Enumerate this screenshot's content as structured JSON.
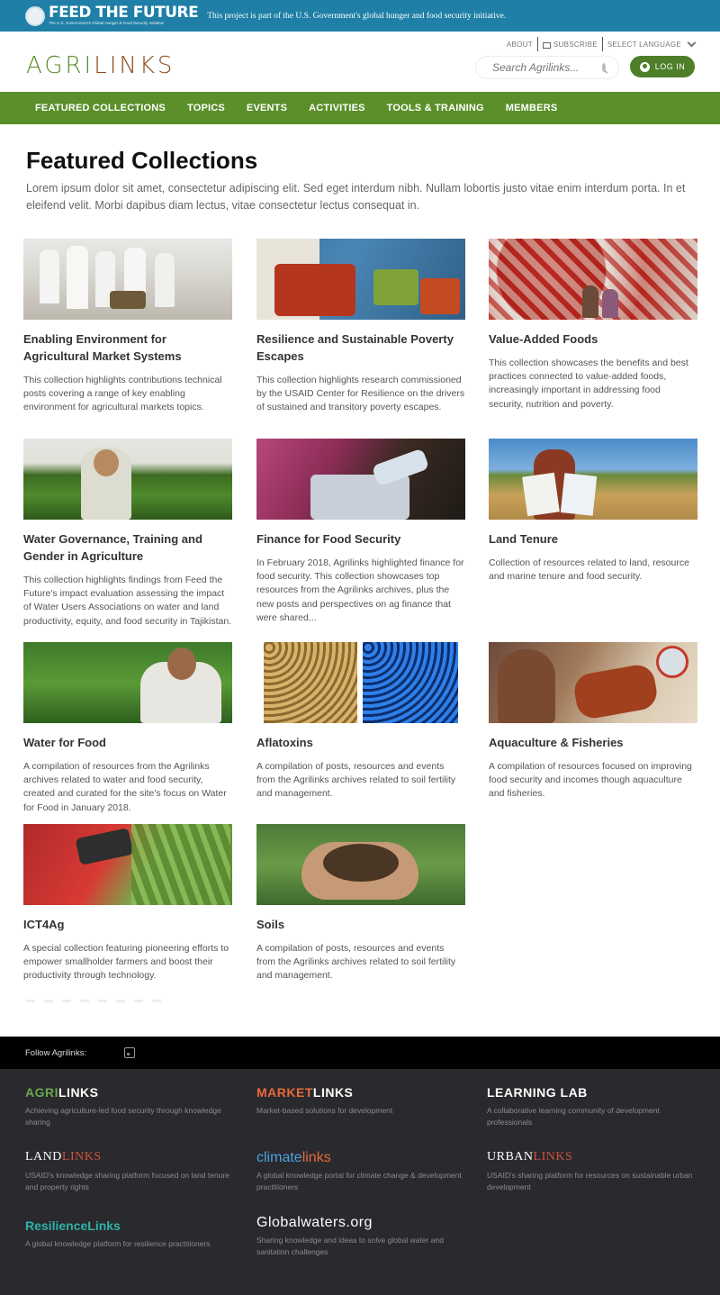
{
  "ftf": {
    "logo": "FEED THE FUTURE",
    "tagline": "The U.S. Government's Global Hunger & Food Security Initiative",
    "description": "This project is part of the U.S. Government's global hunger and food security initiative."
  },
  "header": {
    "util": {
      "about": "ABOUT",
      "subscribe": "SUBSCRIBE",
      "language": "SELECT LANGUAGE"
    },
    "brand": {
      "part1": "AGRI",
      "part2": "LINKS"
    },
    "search_placeholder": "Search Agrilinks...",
    "login": "LOG IN"
  },
  "nav": [
    "FEATURED COLLECTIONS",
    "TOPICS",
    "EVENTS",
    "ACTIVITIES",
    "TOOLS & TRAINING",
    "MEMBERS"
  ],
  "main": {
    "title": "Featured Collections",
    "intro": "Lorem ipsum dolor sit amet, consectetur adipiscing elit. Sed eget interdum nibh. Nullam lobortis justo vitae enim interdum porta. In et eleifend velit. Morbi dapibus diam lectus, vitae consectetur lectus consequat in."
  },
  "collections": [
    {
      "title": "Enabling Environment for Agricultural Market Systems",
      "desc": "This collection highlights contributions technical posts covering a range of key enabling environment for agricultural markets topics."
    },
    {
      "title": "Resilience and Sustainable Poverty Escapes",
      "desc": "This collection highlights research commissioned by the USAID Center for Resilience on the drivers of sustained and transitory poverty escapes."
    },
    {
      "title": "Value-Added Foods",
      "desc": "This collection showcases the benefits and best practices connected to value-added foods, increasingly important in addressing food security, nutrition and poverty."
    },
    {
      "title": "Water Governance, Training and Gender in Agriculture",
      "desc": "This collection highlights findings from Feed the Future's impact evaluation assessing the impact of Water Users Associations on water and land productivity, equity, and food security in Tajikistan."
    },
    {
      "title": "Finance for Food Security",
      "desc": "In February 2018, Agrilinks highlighted finance for food security. This collection showcases top resources from the Agrilinks archives, plus the new posts and perspectives on ag finance that were shared..."
    },
    {
      "title": "Land Tenure",
      "desc": "Collection of resources related to land, resource and marine tenure and food security."
    },
    {
      "title": "Water for Food",
      "desc": "A compilation of resources from the Agrilinks archives related to water and food security, created and curated for the site's focus on Water for Food in January 2018."
    },
    {
      "title": "Aflatoxins",
      "desc": "A compilation of posts, resources and events from the Agrilinks archives related to soil fertility and management."
    },
    {
      "title": "Aquaculture & Fisheries",
      "desc": "A compilation of resources focused on improving food security and incomes though aquaculture and fisheries."
    },
    {
      "title": "ICT4Ag",
      "desc": "A special collection featuring pioneering efforts to empower smallholder farmers and boost their productivity through technology."
    },
    {
      "title": "Soils",
      "desc": "A compilation of posts, resources and events from the Agrilinks archives related to soil fertility and management."
    }
  ],
  "footer": {
    "follow": "Follow Agrilinks:",
    "sites": [
      {
        "a": "AGRI",
        "b": "LINKS",
        "desc": "Achieving agriculture-led food security through knowledge sharing",
        "ca": "#6aa84f",
        "cb": "#ffffff"
      },
      {
        "a": "MARKET",
        "b": "LINKS",
        "desc": "Market-based solutions for development",
        "ca": "#e8693a",
        "cb": "#ffffff"
      },
      {
        "a": "LEARNING",
        "b": " LAB",
        "desc": "A collaborative learning community of development professionals",
        "ca": "#ffffff",
        "cb": "#ffffff"
      },
      {
        "a": "LAND",
        "b": "LINKS",
        "desc": "USAID's knowledge sharing platform focused on land tenure and property rights",
        "ca": "#ffffff",
        "cb": "#d0503c"
      },
      {
        "a": "climate",
        "b": "links",
        "desc": "A global knowledge portal for climate change & development practitioners",
        "ca": "#4aa3df",
        "cb": "#e8693a"
      },
      {
        "a": "URBAN",
        "b": "LINKS",
        "desc": "USAID's sharing platform for resources on sustainable urban development",
        "ca": "#ffffff",
        "cb": "#d0503c"
      },
      {
        "a": "Resilience",
        "b": "Links",
        "desc": "A global knowledge platform for resilience practitioners",
        "ca": "#2fb3a8",
        "cb": "#2fb3a8"
      },
      {
        "a": "Globalwaters",
        "b": ".org",
        "desc": "Sharing knowledge and ideas to solve global water and sanitation challenges",
        "ca": "#ffffff",
        "cb": "#ffffff"
      }
    ]
  }
}
